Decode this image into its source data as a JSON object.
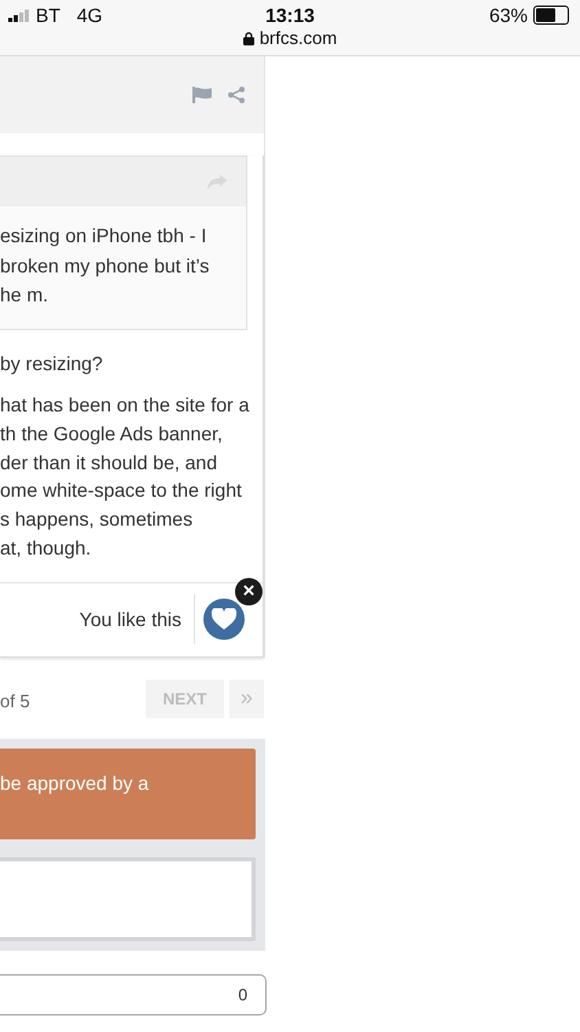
{
  "status_bar": {
    "carrier": "BT",
    "network": "4G",
    "time": "13:13",
    "url": "brfcs.com",
    "battery": "63%"
  },
  "post": {
    "quote": {
      "lines": [
        "esizing on iPhone tbh - I",
        "broken my phone but it’s",
        "he m."
      ]
    },
    "lines_1": [
      "by resizing?"
    ],
    "lines_2": [
      "hat has been on the site for a",
      "th the Google Ads banner,",
      "der than it should be, and",
      "ome white-space to the right",
      "s happens, sometimes",
      "at, though."
    ],
    "like_text": "You like this",
    "liked": true,
    "close_label": "×"
  },
  "pagination": {
    "page_text": "of 5",
    "next": "NEXT",
    "last": "»",
    "next_disabled": true
  },
  "reply": {
    "notice": "be approved by a"
  },
  "count_field": {
    "value": "0"
  }
}
